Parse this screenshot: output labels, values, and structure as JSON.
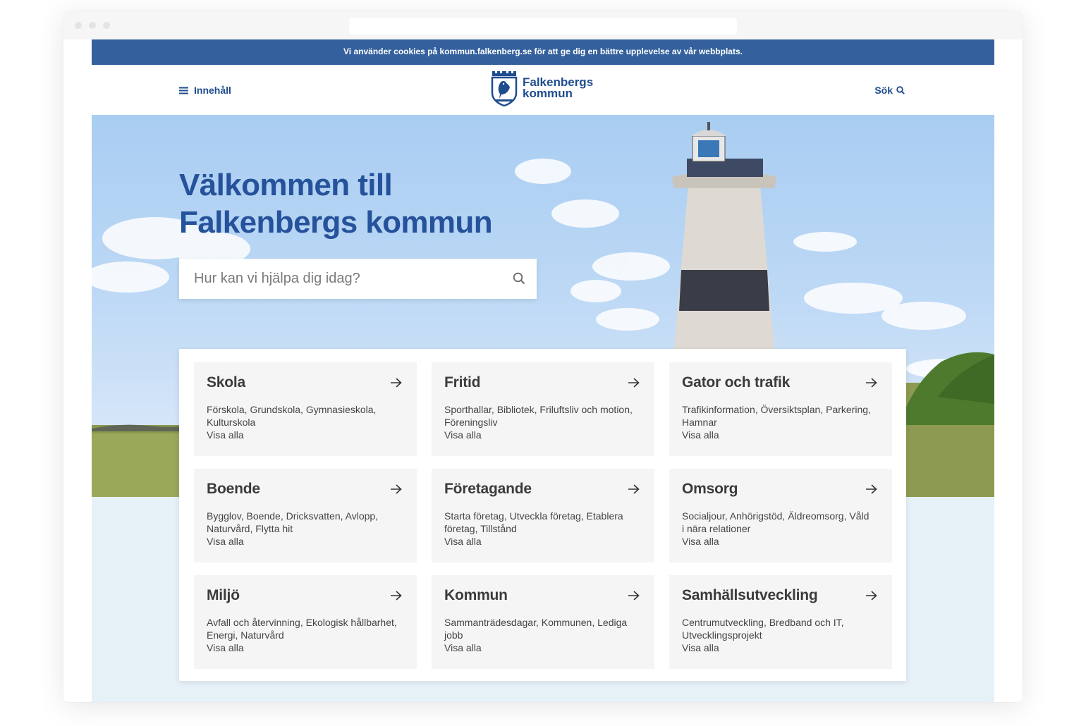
{
  "cookie_notice": "Vi använder cookies på kommun.falkenberg.se för att ge dig en bättre upplevelse av vår webbplats.",
  "header": {
    "menu_label": "Innehåll",
    "logo_line1": "Falkenbergs",
    "logo_line2": "kommun",
    "search_label": "Sök"
  },
  "hero": {
    "title_line1": "Välkommen till",
    "title_line2": "Falkenbergs kommun",
    "search_placeholder": "Hur kan vi hjälpa dig idag?"
  },
  "categories": [
    {
      "title": "Skola",
      "description": "Förskola, Grundskola, Gymnasieskola, Kulturskola",
      "link": "Visa alla"
    },
    {
      "title": "Fritid",
      "description": "Sporthallar, Bibliotek, Friluftsliv och motion, Föreningsliv",
      "link": "Visa alla"
    },
    {
      "title": "Gator och trafik",
      "description": "Trafikinformation, Översiktsplan, Parkering, Hamnar",
      "link": "Visa alla"
    },
    {
      "title": "Boende",
      "description": "Bygglov, Boende, Dricksvatten, Avlopp, Naturvård, Flytta hit",
      "link": "Visa alla"
    },
    {
      "title": "Företagande",
      "description": "Starta företag, Utveckla företag, Etablera företag, Tillstånd",
      "link": "Visa alla"
    },
    {
      "title": "Omsorg",
      "description": "Socialjour, Anhörigstöd, Äldreomsorg, Våld i nära relationer",
      "link": "Visa alla"
    },
    {
      "title": "Miljö",
      "description": "Avfall och återvinning, Ekologisk hållbarhet, Energi, Naturvård",
      "link": "Visa alla"
    },
    {
      "title": "Kommun",
      "description": "Sammanträdesdagar, Kommunen, Lediga jobb",
      "link": "Visa alla"
    },
    {
      "title": "Samhällsutveckling",
      "description": "Centrumutveckling, Bredband och IT, Utvecklingsprojekt",
      "link": "Visa alla"
    }
  ]
}
